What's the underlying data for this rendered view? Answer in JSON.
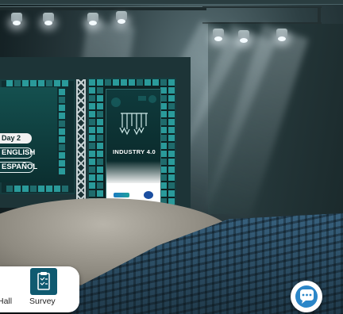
{
  "schedule": {
    "day_label": "Day 2"
  },
  "language": {
    "english_label": "ENGLISH",
    "spanish_label": "ESPAÑOL"
  },
  "poster": {
    "title": "INDUSTRY 4.0"
  },
  "nav": {
    "items": [
      {
        "label": "Hall",
        "icon": "hall-icon"
      },
      {
        "label": "Survey",
        "icon": "survey-icon"
      }
    ]
  },
  "chat": {
    "icon": "chat-bubble-icon"
  },
  "colors": {
    "accent": "#0f5a70",
    "tile": "#2a9a9a",
    "lang_bg": "#0f3c3e"
  }
}
